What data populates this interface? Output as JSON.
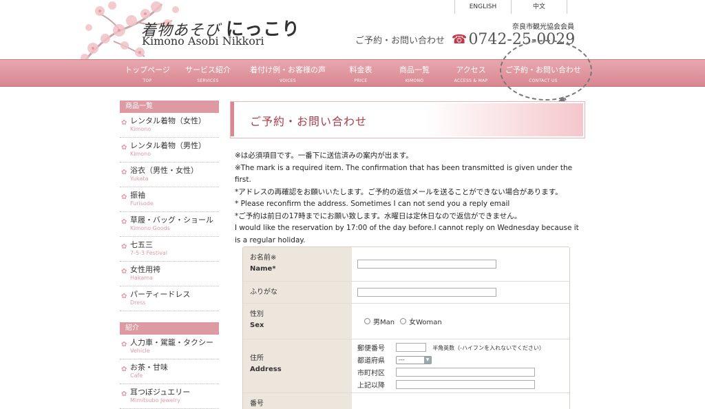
{
  "header": {
    "logo_jp_prefix": "着物あそび",
    "logo_jp_main": "にっこり",
    "logo_en": "Kimono Asobi Nikkori",
    "lang_en": "ENGLISH",
    "lang_zh": "中文",
    "association": "奈良市観光協会会員",
    "contact_label": "ご予約・お問い合わせ",
    "phone_icon": "phone-icon",
    "phone": "0742-25-0029"
  },
  "nav": [
    {
      "jp": "トップページ",
      "en": "TOP"
    },
    {
      "jp": "サービス紹介",
      "en": "SERVICES"
    },
    {
      "jp": "着付け例・お客様の声",
      "en": "VOICES"
    },
    {
      "jp": "料金表",
      "en": "PRICE"
    },
    {
      "jp": "商品一覧",
      "en": "KIMONO"
    },
    {
      "jp": "アクセス",
      "en": "ACCESS & MAP"
    },
    {
      "jp": "ご予約・お問い合わせ",
      "en": "CONTACT US"
    }
  ],
  "sidebar": {
    "products_heading": "商品一覧",
    "products": [
      {
        "jp": "レンタル着物（女性）",
        "en": "Kimono"
      },
      {
        "jp": "レンタル着物（男性）",
        "en": "Kimono"
      },
      {
        "jp": "浴衣（男性・女性）",
        "en": "Yukata"
      },
      {
        "jp": "振袖",
        "en": "Furisode"
      },
      {
        "jp": "草履・バッグ・ショール",
        "en": "Kimono Goods"
      },
      {
        "jp": "七五三",
        "en": "7-5-3 Festival"
      },
      {
        "jp": "女性用袴",
        "en": "Hakama"
      },
      {
        "jp": "パーティードレス",
        "en": "Dress"
      }
    ],
    "intro_heading": "紹介",
    "intro": [
      {
        "jp": "人力車・駕籠・タクシー",
        "en": "Vehicle"
      },
      {
        "jp": "お茶・甘味",
        "en": "Cafe"
      },
      {
        "jp": "耳つぼジュエリー",
        "en": "Mimitsubo Jewelry"
      }
    ]
  },
  "page_title": "ご予約・お問い合わせ",
  "notes": [
    "※は必須項目です。一番下に送信済みの案内が出ます。",
    "※The mark is a required item. The confirmation that has been transmitted is given under the first.",
    "*アドレスの再確認をお願いいたします。ご予約の返信メールを送ることができない場合があります。",
    "* Please reconfirm the address. Sometimes I can not send you a reply email",
    "*ご予約は前日の17時までにお願い致します。水曜日は定休日なので返信ができません。",
    "I would like the reservation by 17:00 of the day before.I cannot reply on Wednesday because it is a regular holiday."
  ],
  "form": {
    "name_jp": "お名前※",
    "name_en": "Name*",
    "furigana": "ふりがな",
    "sex_jp": "性別",
    "sex_en": "Sex",
    "sex_male": "男Man",
    "sex_female": "女Woman",
    "address_jp": "住所",
    "address_en": "Address",
    "postal_label": "郵便番号",
    "postal_hint": "半角英数（-ハイフンを入れないでください）",
    "prefecture_label": "都道府県",
    "prefecture_value": "---",
    "city_label": "市町村区",
    "street_label": "上記以降",
    "number_jp": "番号"
  }
}
